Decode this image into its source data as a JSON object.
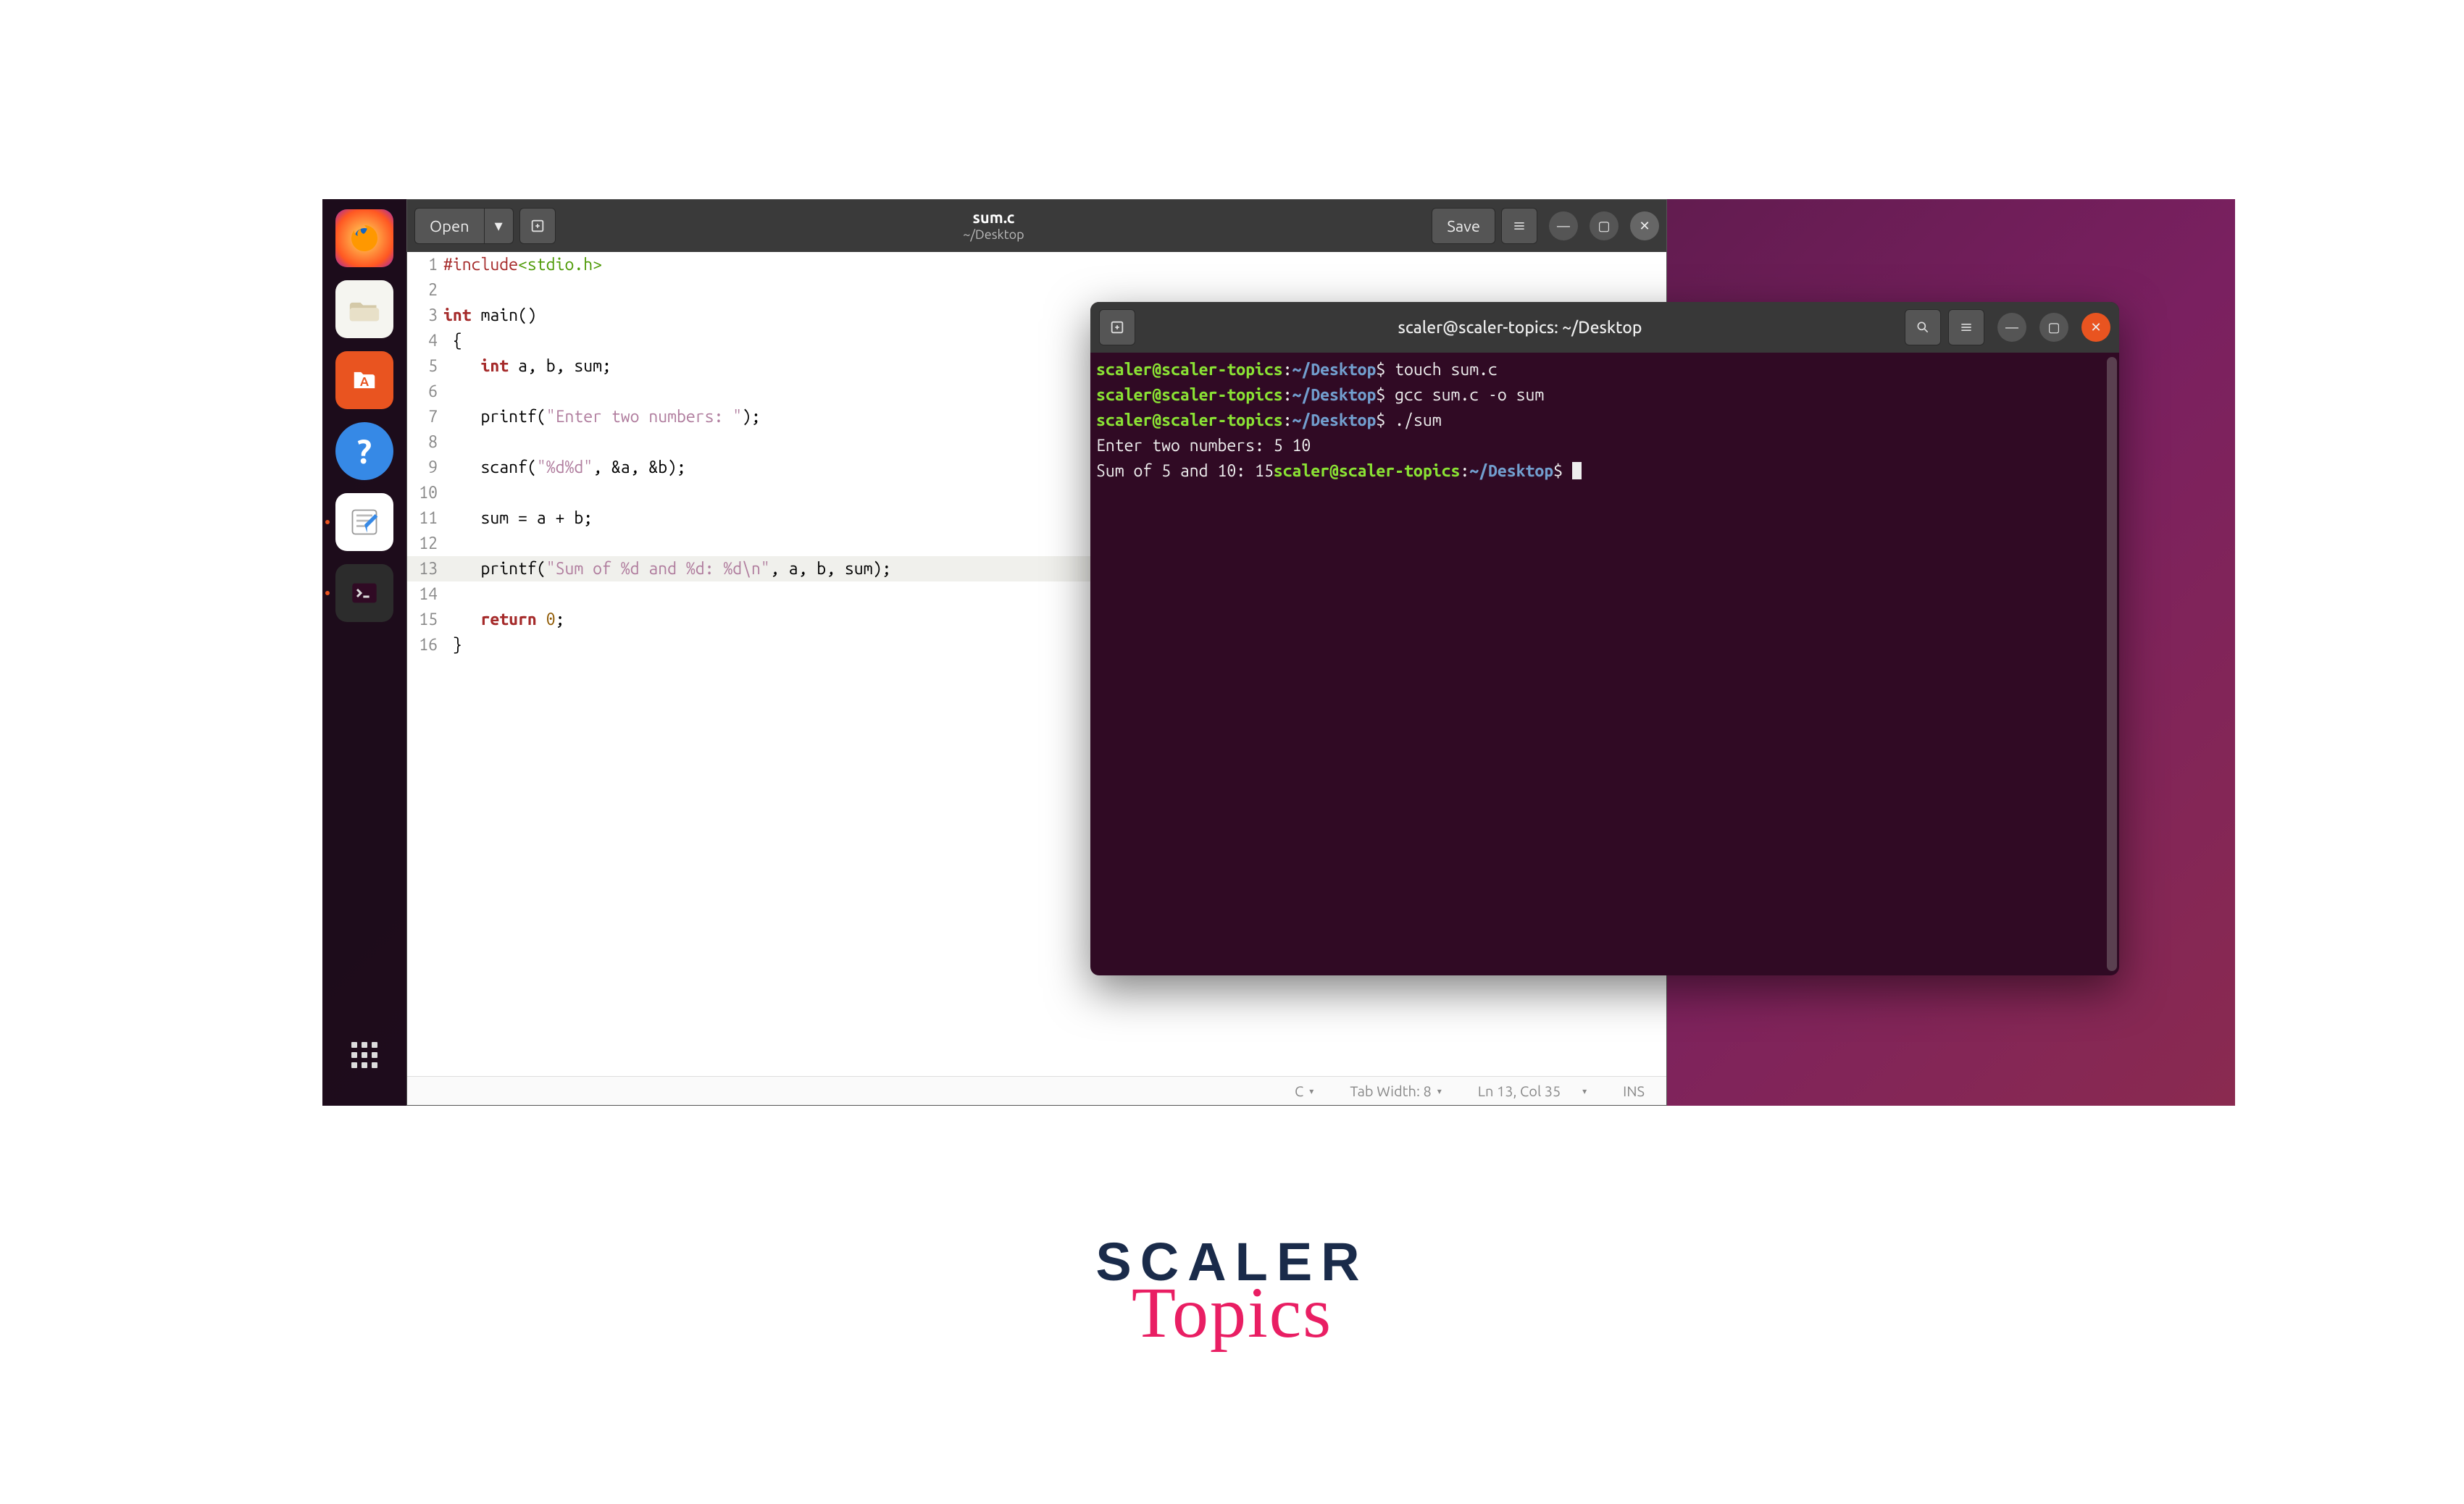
{
  "gedit": {
    "open_label": "Open",
    "save_label": "Save",
    "filename": "sum.c",
    "filepath": "~/Desktop",
    "status": {
      "language": "C",
      "tab_width": "Tab Width: 8",
      "position": "Ln 13, Col 35",
      "insert_mode": "INS"
    },
    "lines": [
      {
        "n": 1,
        "segs": [
          {
            "t": "#include",
            "c": "pp"
          },
          {
            "t": "<stdio.h>",
            "c": "inc"
          }
        ]
      },
      {
        "n": 2,
        "segs": []
      },
      {
        "n": 3,
        "segs": [
          {
            "t": "int",
            "c": "kw"
          },
          {
            "t": " main()"
          }
        ]
      },
      {
        "n": 4,
        "segs": [
          {
            "t": " {"
          }
        ]
      },
      {
        "n": 5,
        "segs": [
          {
            "t": "    "
          },
          {
            "t": "int",
            "c": "kw"
          },
          {
            "t": " a, b, sum;"
          }
        ]
      },
      {
        "n": 6,
        "segs": []
      },
      {
        "n": 7,
        "segs": [
          {
            "t": "    printf("
          },
          {
            "t": "\"Enter two numbers: \"",
            "c": "str"
          },
          {
            "t": ");"
          }
        ]
      },
      {
        "n": 8,
        "segs": []
      },
      {
        "n": 9,
        "segs": [
          {
            "t": "    scanf("
          },
          {
            "t": "\"%d%d\"",
            "c": "str"
          },
          {
            "t": ", &a, &b);"
          }
        ]
      },
      {
        "n": 10,
        "segs": []
      },
      {
        "n": 11,
        "segs": [
          {
            "t": "    sum = a + b;"
          }
        ]
      },
      {
        "n": 12,
        "segs": []
      },
      {
        "n": 13,
        "segs": [
          {
            "t": "    printf("
          },
          {
            "t": "\"Sum of %d and %d: %d\\n\"",
            "c": "str"
          },
          {
            "t": ", a, b, sum);"
          }
        ]
      },
      {
        "n": 14,
        "segs": []
      },
      {
        "n": 15,
        "segs": [
          {
            "t": "    "
          },
          {
            "t": "return",
            "c": "kw"
          },
          {
            "t": " "
          },
          {
            "t": "0",
            "c": "num"
          },
          {
            "t": ";"
          }
        ]
      },
      {
        "n": 16,
        "segs": [
          {
            "t": " }"
          }
        ]
      }
    ]
  },
  "terminal": {
    "title": "scaler@scaler-topics: ~/Desktop",
    "prompt_user": "scaler@scaler-topics",
    "prompt_colon": ":",
    "prompt_path": "~/Desktop",
    "prompt_dollar": "$",
    "lines": [
      {
        "cmd": " touch sum.c"
      },
      {
        "cmd": " gcc sum.c -o sum"
      },
      {
        "cmd": " ./sum"
      },
      {
        "out": "Enter two numbers: 5 10"
      },
      {
        "out_inline": "Sum of 5 and 10: 15",
        "prompt_after": true
      }
    ]
  },
  "dock": {
    "items": [
      {
        "name": "firefox-icon",
        "bg": "#ff7139",
        "emoji": ""
      },
      {
        "name": "files-icon",
        "bg": "#dedede"
      },
      {
        "name": "software-icon",
        "bg": "#e95420"
      },
      {
        "name": "help-icon",
        "bg": "#3689e6"
      },
      {
        "name": "gedit-icon",
        "bg": "#ffffff",
        "running": true
      },
      {
        "name": "terminal-icon",
        "bg": "#2c2c2c",
        "running": true
      }
    ]
  },
  "logo": {
    "scaler": "SCALER",
    "topics": "Topics"
  }
}
